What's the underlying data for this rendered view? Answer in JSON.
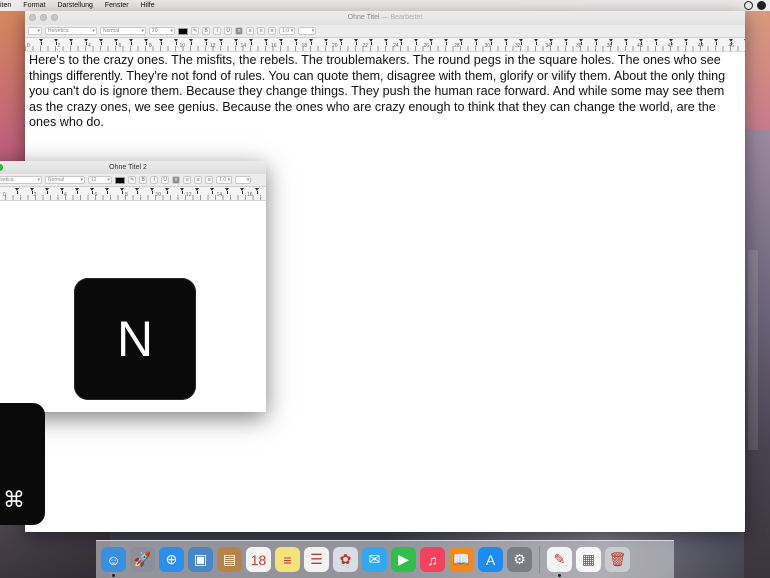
{
  "menubar": {
    "items": [
      "iten",
      "Format",
      "Darstellung",
      "Fenster",
      "Hilfe"
    ]
  },
  "main_window": {
    "title": "Ohne Titel",
    "edited_suffix": "— Bearbeitet",
    "toolbar": {
      "font_family": "Helvetica",
      "font_style": "Normal",
      "font_size": "20",
      "bold": "B",
      "italic": "I",
      "underline": "U",
      "line_spacing": "1,0"
    },
    "ruler_numbers": [
      "0",
      "2",
      "4",
      "6",
      "8",
      "10",
      "12",
      "14",
      "16",
      "18",
      "20",
      "22",
      "24",
      "26",
      "28",
      "30",
      "32",
      "34",
      "36",
      "38",
      "40",
      "42",
      "44",
      "46"
    ],
    "document_text": "Here's to the crazy ones. The misfits, the rebels. The troublemakers. The round pegs in the square holes. The ones who see things differently. They're not fond of rules. You can quote them, disagree with them, glorify or vilify them. About the only thing you can't do is ignore them. Because they change things. They push the human race forward. And while some may see them as the crazy ones, we see genius. Because the ones who are crazy enough to think that they can change the world, are the ones who do."
  },
  "second_window": {
    "title": "Ohne Titel 2",
    "toolbar": {
      "font_family": "Helvetica",
      "font_style": "Normal",
      "font_size": "12",
      "bold": "B",
      "italic": "I",
      "underline": "U",
      "line_spacing": "1,0"
    },
    "ruler_numbers": [
      "0",
      "2",
      "4",
      "6",
      "8",
      "10",
      "12",
      "14",
      "16",
      "18"
    ]
  },
  "key_overlays": {
    "n_key": "N",
    "cmd_key": "⌘"
  },
  "dock": {
    "icons": [
      {
        "name": "finder-icon",
        "color": "#3b8fe0",
        "glyph": "☺",
        "running": true
      },
      {
        "name": "launchpad-icon",
        "color": "#8a8f99",
        "glyph": "🚀",
        "running": false
      },
      {
        "name": "safari-icon",
        "color": "#2c8ee8",
        "glyph": "⊕",
        "running": false
      },
      {
        "name": "preview-icon",
        "color": "#4a86c6",
        "glyph": "▣",
        "running": false
      },
      {
        "name": "contacts-icon",
        "color": "#b5844a",
        "glyph": "▤",
        "running": false
      },
      {
        "name": "calendar-icon",
        "color": "#f4f4f4",
        "glyph": "18",
        "running": false
      },
      {
        "name": "notes-icon",
        "color": "#f5e27a",
        "glyph": "≡",
        "running": false
      },
      {
        "name": "reminders-icon",
        "color": "#f2f2f2",
        "glyph": "☰",
        "running": false
      },
      {
        "name": "photos-icon",
        "color": "#d9dde4",
        "glyph": "✿",
        "running": false
      },
      {
        "name": "messages-icon",
        "color": "#34a8ef",
        "glyph": "✉",
        "running": false
      },
      {
        "name": "facetime-icon",
        "color": "#2fbf4a",
        "glyph": "▶",
        "running": false
      },
      {
        "name": "itunes-icon",
        "color": "#f2425e",
        "glyph": "♫",
        "running": false
      },
      {
        "name": "ibooks-icon",
        "color": "#f08a1c",
        "glyph": "📖",
        "running": false
      },
      {
        "name": "app-store-icon",
        "color": "#1e8cef",
        "glyph": "A",
        "running": false
      },
      {
        "name": "system-preferences-icon",
        "color": "#7a7d82",
        "glyph": "⚙",
        "running": false
      },
      {
        "name": "textedit-icon",
        "color": "#f4f4f4",
        "glyph": "✎",
        "running": true
      },
      {
        "name": "document-icon",
        "color": "#f7f7f7",
        "glyph": "▦",
        "running": false
      },
      {
        "name": "trash-icon",
        "color": "#c9ccd1",
        "glyph": "🗑",
        "running": false
      }
    ]
  }
}
